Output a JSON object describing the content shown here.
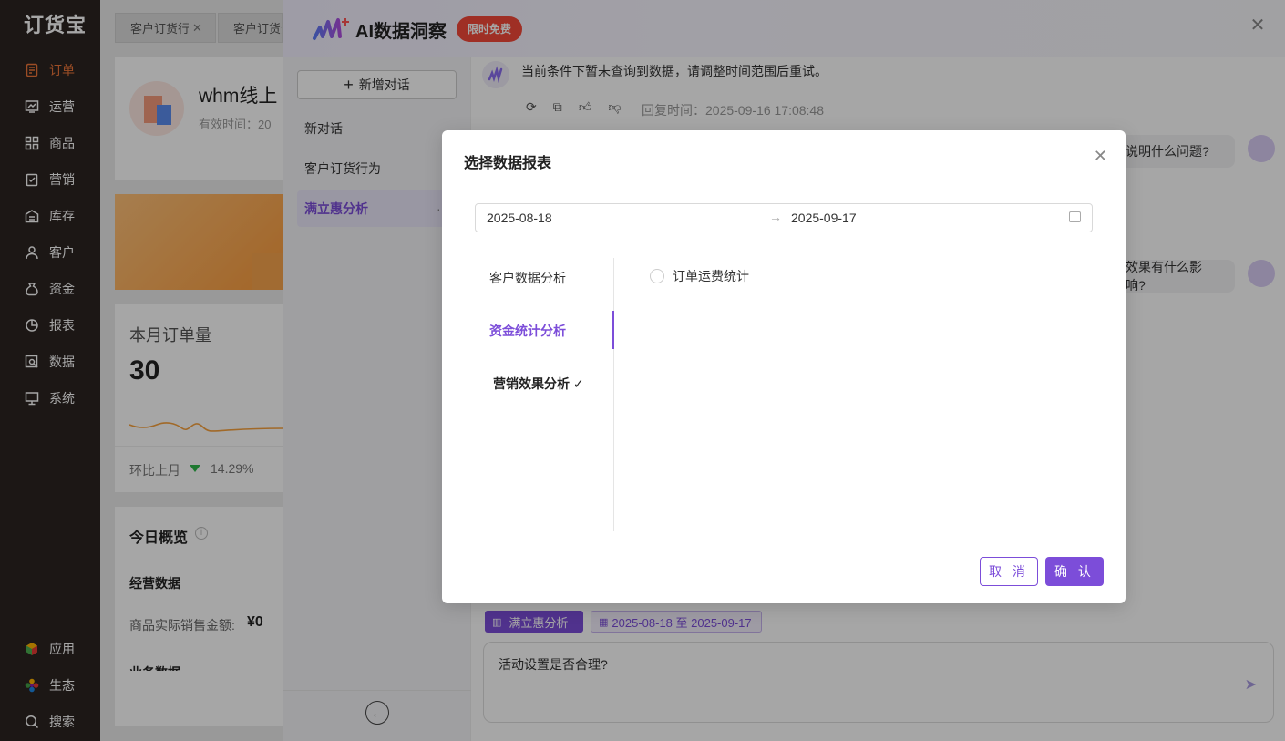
{
  "app": {
    "logo": "订货宝"
  },
  "sidebar": {
    "items": [
      {
        "label": "订单",
        "icon": "order-icon"
      },
      {
        "label": "运营",
        "icon": "operation-icon"
      },
      {
        "label": "商品",
        "icon": "product-icon"
      },
      {
        "label": "营销",
        "icon": "marketing-icon"
      },
      {
        "label": "库存",
        "icon": "inventory-icon"
      },
      {
        "label": "客户",
        "icon": "customer-icon"
      },
      {
        "label": "资金",
        "icon": "funds-icon"
      },
      {
        "label": "报表",
        "icon": "report-icon"
      },
      {
        "label": "数据",
        "icon": "data-icon"
      },
      {
        "label": "系统",
        "icon": "system-icon"
      }
    ],
    "bottom": [
      {
        "label": "应用",
        "icon": "app-cube-icon"
      },
      {
        "label": "生态",
        "icon": "ecosystem-icon"
      },
      {
        "label": "搜索",
        "icon": "search-icon"
      }
    ],
    "active_color": "#f0773a"
  },
  "tabs": [
    {
      "label": "客户订货行为"
    },
    {
      "label": "客户订货分"
    }
  ],
  "background": {
    "store_name": "whm线上",
    "valid_time_label": "有效时间：20",
    "stat_title": "本月订单量",
    "stat_value": "30",
    "compare_label": "环比上月",
    "compare_value": "14.29%",
    "today_title": "今日概览",
    "business_title": "经营数据",
    "sales_label": "商品实际销售金额:",
    "sales_value": "¥0",
    "more_title": "业务数据"
  },
  "ai_panel": {
    "title": "AI数据洞察",
    "badge": "限时免费",
    "new_chat": "新增对话",
    "conversations": [
      "新对话",
      "客户订货行为",
      "满立惠分析"
    ],
    "active_conversation": "满立惠分析",
    "more_label": "···",
    "accent_color": "#7c4dd9",
    "messages": {
      "ai_text": "当前条件下暂未查询到数据，请调整时间范围后重试。",
      "reply_time": "回复时间：2025-09-16 17:08:48",
      "user_q1": "说明什么问题?",
      "user_q2": "效果有什么影响?"
    },
    "context_tag": "满立惠分析",
    "date_tag": "2025-08-18 至 2025-09-17",
    "input_text": "活动设置是否合理?"
  },
  "dialog": {
    "title": "选择数据报表",
    "date_start": "2025-08-18",
    "date_end": "2025-09-17",
    "arrow": "→",
    "categories": [
      {
        "label": "客户数据分析",
        "state": "normal"
      },
      {
        "label": "资金统计分析",
        "state": "active"
      },
      {
        "label": "营销效果分析 ✓",
        "state": "checked"
      }
    ],
    "options": [
      {
        "label": "订单运费统计",
        "checked": false
      }
    ],
    "cancel": "取 消",
    "confirm": "确 认"
  }
}
